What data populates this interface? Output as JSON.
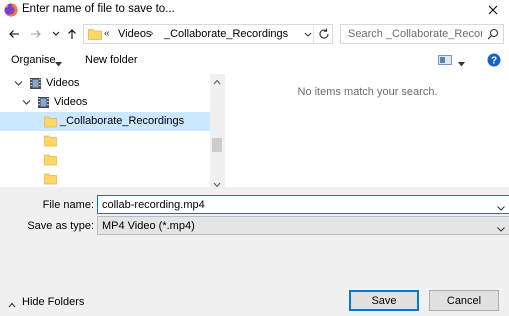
{
  "window": {
    "title": "Enter name of file to save to...",
    "accent_color": "#0078d7",
    "selection_color": "#cce8ff"
  },
  "icons": {
    "app": "firefox-icon",
    "close": "close-icon",
    "back": "arrow-left-icon",
    "forward": "arrow-right-icon",
    "recent": "chevron-down-icon",
    "up": "arrow-up-icon",
    "folder": "folder-icon",
    "refresh": "refresh-icon",
    "search": "search-icon",
    "view": "view-options-icon",
    "help": "help-icon",
    "videos": "videos-library-icon"
  },
  "address": {
    "overflow": "«",
    "parts": [
      "Videos",
      "_Collaborate_Recordings"
    ],
    "separator": "›"
  },
  "search": {
    "placeholder": "Search _Collaborate_Recordings"
  },
  "toolbar": {
    "organise": "Organise",
    "new_folder": "New folder"
  },
  "tree": {
    "items": [
      {
        "label": "Videos",
        "expanded": true
      },
      {
        "label": "Videos",
        "expanded": true
      },
      {
        "label": "_Collaborate_Recordings",
        "selected": true
      },
      {
        "label": ""
      },
      {
        "label": ""
      },
      {
        "label": ""
      }
    ]
  },
  "content": {
    "empty_message": "No items match your search."
  },
  "form": {
    "file_name_label": "File name:",
    "file_name_value": "collab-recording.mp4",
    "save_as_type_label": "Save as type:",
    "save_as_type_value": "MP4 Video (*.mp4)"
  },
  "footer": {
    "hide_folders": "Hide Folders",
    "save": "Save",
    "cancel": "Cancel"
  }
}
